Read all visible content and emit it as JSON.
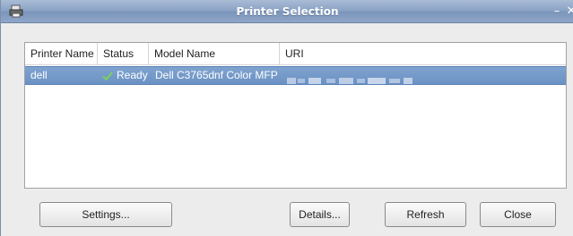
{
  "window": {
    "title": "Printer Selection",
    "app_icon": "printer-icon",
    "minimize_glyph": "–",
    "close_glyph": "✕",
    "title_color": "#ffffff"
  },
  "printer_list": {
    "columns": [
      "Printer Name",
      "Status",
      "Model Name",
      "URI"
    ],
    "rows": [
      {
        "printer_name": "dell",
        "status_icon": "checkmark-icon",
        "status": "Ready",
        "model_name": "Dell C3765dnf Color MFP",
        "uri_blurred": true
      }
    ],
    "selected_row_color": "#7499c8"
  },
  "buttons": {
    "settings": "Settings...",
    "details": "Details...",
    "refresh": "Refresh",
    "close": "Close"
  }
}
